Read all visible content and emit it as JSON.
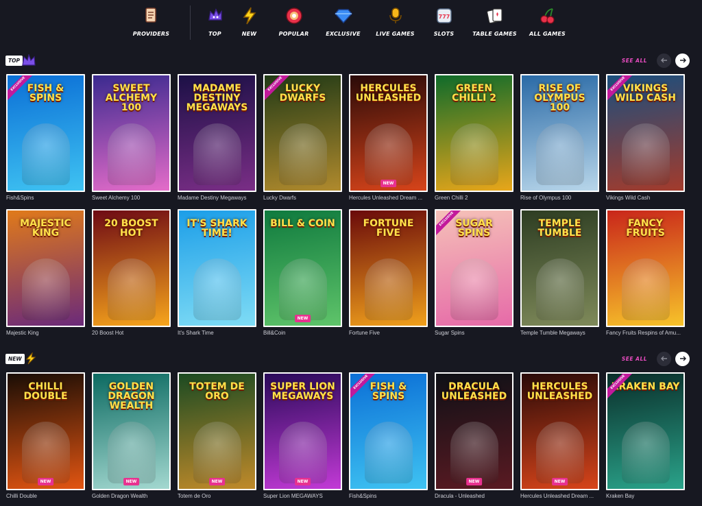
{
  "nav": {
    "items": [
      {
        "label": "PROVIDERS",
        "icon": "scroll-icon"
      },
      {
        "label": "TOP",
        "icon": "crown-icon"
      },
      {
        "label": "NEW",
        "icon": "lightning-icon"
      },
      {
        "label": "POPULAR",
        "icon": "donut-icon"
      },
      {
        "label": "EXCLUSIVE",
        "icon": "diamond-icon"
      },
      {
        "label": "LIVE GAMES",
        "icon": "microphone-icon"
      },
      {
        "label": "SLOTS",
        "icon": "slot-machine-icon"
      },
      {
        "label": "TABLE GAMES",
        "icon": "playing-cards-icon"
      },
      {
        "label": "ALL GAMES",
        "icon": "cherries-icon"
      }
    ]
  },
  "sections": {
    "top": {
      "badge": "TOP",
      "see_all": "SEE ALL"
    },
    "new": {
      "badge": "NEW",
      "see_all": "SEE ALL"
    }
  },
  "tags": {
    "new": "NEW",
    "exclusive": "EXCLUSIVE"
  },
  "top_row_1": [
    {
      "art": "FISH & SPINS",
      "caption": "Fish&Spins",
      "bg": [
        "#0b6fd6",
        "#3fc3f2"
      ],
      "exclusive": true,
      "new": false
    },
    {
      "art": "SWEET ALCHEMY 100",
      "caption": "Sweet Alchemy 100",
      "bg": [
        "#3b2a8f",
        "#e46cc9"
      ],
      "exclusive": false,
      "new": false
    },
    {
      "art": "MADAME DESTINY MEGAWAYS",
      "caption": "Madame Destiny Megaways",
      "bg": [
        "#1c1046",
        "#7a2e86"
      ],
      "exclusive": false,
      "new": false
    },
    {
      "art": "LUCKY DWARFS",
      "caption": "Lucky Dwarfs",
      "bg": [
        "#213a16",
        "#b08a2d"
      ],
      "exclusive": true,
      "new": false
    },
    {
      "art": "HERCULES UNLEASHED",
      "caption": "Hercules Unleashed Dream ...",
      "bg": [
        "#2a0a08",
        "#d7441a"
      ],
      "exclusive": false,
      "new": true
    },
    {
      "art": "GREEN CHILLI 2",
      "caption": "Green Chilli 2",
      "bg": [
        "#0f6b2a",
        "#e8a61a"
      ],
      "exclusive": false,
      "new": false
    },
    {
      "art": "RISE OF OLYMPUS 100",
      "caption": "Rise of Olympus 100",
      "bg": [
        "#2a6aa6",
        "#b8d6ea"
      ],
      "exclusive": false,
      "new": false
    },
    {
      "art": "VIKINGS WILD CASH",
      "caption": "Vikings Wild Cash",
      "bg": [
        "#1b4e7d",
        "#a33b2c"
      ],
      "exclusive": true,
      "new": false
    }
  ],
  "top_row_2": [
    {
      "art": "MAJESTIC KING",
      "caption": "Majestic King",
      "bg": [
        "#e07a1a",
        "#6b2a7a"
      ],
      "exclusive": false,
      "new": false
    },
    {
      "art": "20 BOOST HOT",
      "caption": "20 Boost Hot",
      "bg": [
        "#6e0a14",
        "#f7a51c"
      ],
      "exclusive": false,
      "new": false
    },
    {
      "art": "IT'S SHARK TIME!",
      "caption": "It's Shark Time",
      "bg": [
        "#1c9ee8",
        "#7fdcf5"
      ],
      "exclusive": false,
      "new": false
    },
    {
      "art": "BILL & COIN",
      "caption": "Bill&Coin",
      "bg": [
        "#0f7a3e",
        "#5fc46a"
      ],
      "exclusive": false,
      "new": true
    },
    {
      "art": "FORTUNE FIVE",
      "caption": "Fortune Five",
      "bg": [
        "#6a0a0a",
        "#f0a01c"
      ],
      "exclusive": false,
      "new": false
    },
    {
      "art": "SUGAR SPINS",
      "caption": "Sugar Spins",
      "bg": [
        "#f5c1b8",
        "#e66aa8"
      ],
      "exclusive": true,
      "new": false
    },
    {
      "art": "TEMPLE TUMBLE",
      "caption": "Temple Tumble Megaways",
      "bg": [
        "#2d3d22",
        "#7f8a5a"
      ],
      "exclusive": false,
      "new": false
    },
    {
      "art": "FANCY FRUITS",
      "caption": "Fancy Fruits Respins of Amu...",
      "bg": [
        "#c9261a",
        "#f7c32a"
      ],
      "exclusive": false,
      "new": false
    }
  ],
  "new_row": [
    {
      "art": "CHILLI DOUBLE",
      "caption": "Chilli Double",
      "bg": [
        "#1a0d05",
        "#e25512"
      ],
      "exclusive": false,
      "new": true
    },
    {
      "art": "GOLDEN DRAGON WEALTH",
      "caption": "Golden Dragon Wealth",
      "bg": [
        "#0c6a61",
        "#a3d8d0"
      ],
      "exclusive": false,
      "new": true
    },
    {
      "art": "TOTEM DE ORO",
      "caption": "Totem de Oro",
      "bg": [
        "#1b4a22",
        "#c08a2a"
      ],
      "exclusive": false,
      "new": true
    },
    {
      "art": "SUPER LION MEGAWAYS",
      "caption": "Super Lion MEGAWAYS",
      "bg": [
        "#2a0a5a",
        "#c23ad6"
      ],
      "exclusive": false,
      "new": true
    },
    {
      "art": "FISH & SPINS",
      "caption": "Fish&Spins",
      "bg": [
        "#0b6fd6",
        "#3fc3f2"
      ],
      "exclusive": true,
      "new": false
    },
    {
      "art": "DRACULA UNLEASHED",
      "caption": "Dracula - Unleashed",
      "bg": [
        "#0e1016",
        "#5a1a22"
      ],
      "exclusive": false,
      "new": true
    },
    {
      "art": "HERCULES UNLEASHED",
      "caption": "Hercules Unleashed Dream ...",
      "bg": [
        "#2a0a08",
        "#d7441a"
      ],
      "exclusive": false,
      "new": true
    },
    {
      "art": "KRAKEN BAY",
      "caption": "Kraken Bay",
      "bg": [
        "#0a2e2a",
        "#2aa38a"
      ],
      "exclusive": true,
      "new": false
    }
  ]
}
